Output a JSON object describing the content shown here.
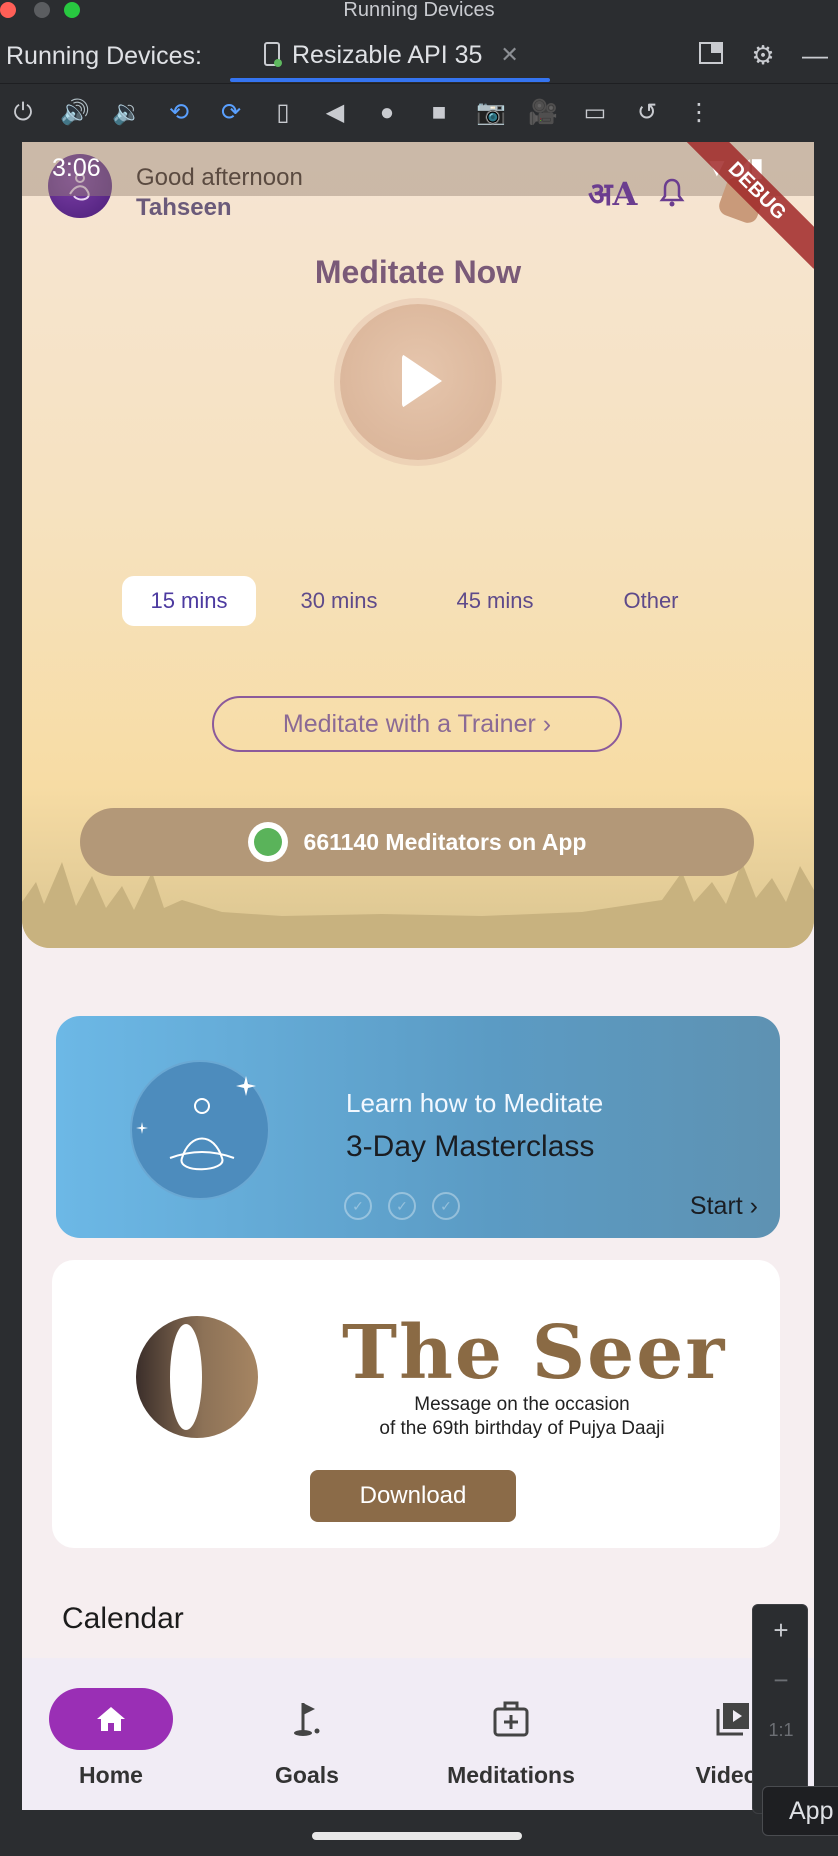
{
  "ide": {
    "window_title": "Running Devices",
    "panel_label": "Running Devices:",
    "active_tab": "Resizable API 35",
    "tab_close": "✕",
    "toolbar_icons": [
      "power-icon",
      "volume-up-icon",
      "volume-down-icon",
      "rotate-left-icon",
      "rotate-right-icon",
      "fold-icon",
      "back-icon",
      "home-icon",
      "overview-icon",
      "camera-icon",
      "record-icon",
      "device-frame-icon",
      "reset-icon",
      "more-icon"
    ]
  },
  "status": {
    "time": "3:06"
  },
  "header": {
    "greeting": "Good afternoon",
    "user_name": "Tahseen",
    "language_icon_text": "अA",
    "debug_banner": "DEBUG"
  },
  "meditate": {
    "title": "Meditate Now",
    "durations": [
      "15 mins",
      "30 mins",
      "45 mins",
      "Other"
    ],
    "selected_duration": "15 mins",
    "trainer_button": "Meditate with a Trainer ›",
    "meditators_count_text": "661140 Meditators on App"
  },
  "masterclass": {
    "subtitle": "Learn how to Meditate",
    "title": "3-Day Masterclass",
    "days_completed": 0,
    "days_total": 3,
    "start_label": "Start ›"
  },
  "seer": {
    "title": "The Seer",
    "line1": "Message on the occasion",
    "line2": "of the 69th birthday of Pujya Daaji",
    "download_label": "Download"
  },
  "calendar": {
    "title": "Calendar"
  },
  "bottom_nav": {
    "items": [
      {
        "label": "Home",
        "icon": "home-icon",
        "active": true
      },
      {
        "label": "Goals",
        "icon": "golf-flag-icon",
        "active": false
      },
      {
        "label": "Meditations",
        "icon": "medical-kit-icon",
        "active": false
      },
      {
        "label": "Videos",
        "icon": "video-library-icon",
        "active": false,
        "badge": true
      }
    ]
  },
  "zoom_panel": {
    "plus": "+",
    "minus": "−",
    "one_to_one": "1:1"
  },
  "tooltip": {
    "text": "App"
  },
  "colors": {
    "accent_purple": "#9a2fb5",
    "pill_brown": "#b39878",
    "download_brown": "#8b6b48",
    "masterclass_blue": "#5b9bc4"
  }
}
